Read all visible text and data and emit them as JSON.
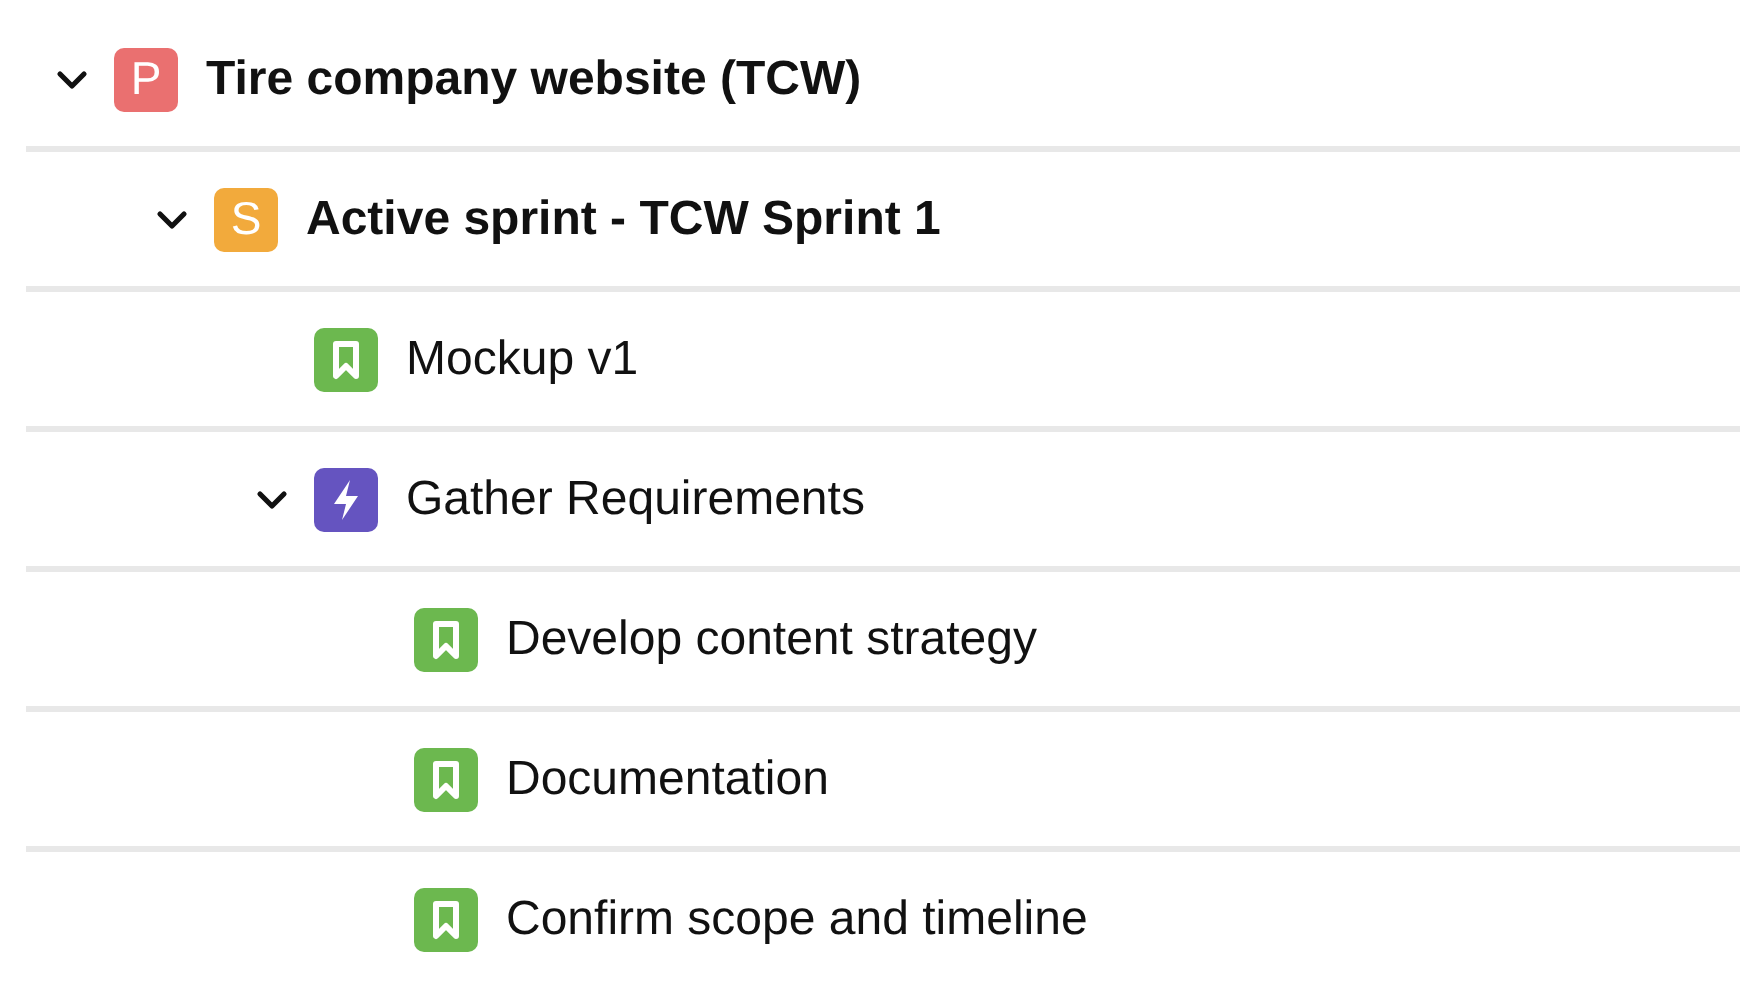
{
  "tree": [
    {
      "title": "Tire company website (TCW)",
      "kind": "project",
      "badge": "P",
      "color": "#ea7070",
      "expanded": true,
      "children": [
        {
          "title": "Active sprint - TCW Sprint 1",
          "kind": "sprint",
          "badge": "S",
          "color": "#f2aa3c",
          "expanded": true,
          "children": [
            {
              "title": "Mockup v1",
              "kind": "story"
            },
            {
              "title": "Gather Requirements",
              "kind": "epic",
              "expanded": true,
              "children": [
                {
                  "title": "Develop content strategy",
                  "kind": "story"
                },
                {
                  "title": "Documentation",
                  "kind": "story"
                },
                {
                  "title": "Confirm scope and timeline",
                  "kind": "story"
                }
              ]
            }
          ]
        }
      ]
    }
  ]
}
